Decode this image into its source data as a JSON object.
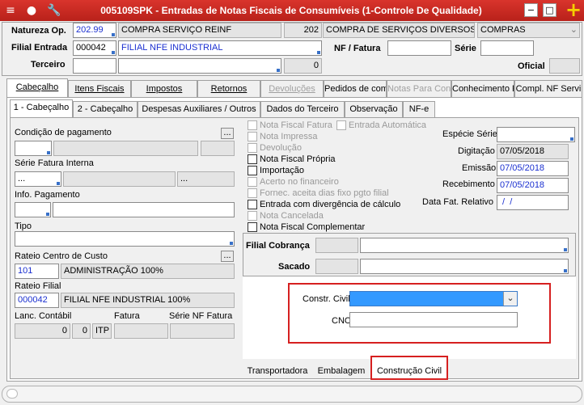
{
  "window": {
    "title": "005109SPK - Entradas de Notas Fiscais de Consumíveis (1-Controle De Qualidade)",
    "menu_icon": "menu-icon",
    "traffic_icon": "traffic-light-icon",
    "tools_icon": "wrench-icon",
    "buttons": {
      "minimize": "−",
      "maximize": "□",
      "close": "×",
      "add": "+"
    }
  },
  "header": {
    "natureza_label": "Natureza Op.",
    "natureza_code": "202.99",
    "natureza_desc": "COMPRA SERVIÇO REINF",
    "group_code": "202",
    "group_desc": "COMPRA DE SERVIÇOS DIVERSOS",
    "type_select": "COMPRAS",
    "filial_label": "Filial Entrada",
    "filial_code": "000042",
    "filial_desc": "FILIAL NFE INDUSTRIAL",
    "nf_label": "NF / Fatura",
    "serie_label": "Série",
    "terceiro_label": "Terceiro",
    "terceiro_num": "0",
    "oficial_label": "Oficial"
  },
  "tabs": [
    "Cabeçalho",
    "Itens Fiscais",
    "Impostos",
    "Retornos",
    "Devoluções",
    "Pedidos de com",
    "Notas Para Con",
    "Conhecimento F",
    "Compl. NF Servi"
  ],
  "subtabs": [
    "1 - Cabeçalho",
    "2 - Cabeçalho",
    "Despesas Auxiliares / Outros",
    "Dados do Terceiro",
    "Observação",
    "NF-e"
  ],
  "left": {
    "condicao_label": "Condição de pagamento",
    "serie_fatura_label": "Série Fatura Interna",
    "serie_fatura_values": [
      "...",
      "..."
    ],
    "info_pagamento_label": "Info. Pagamento",
    "tipo_label": "Tipo",
    "rateio_cc_label": "Rateio Centro de Custo",
    "rateio_cc_code": "101",
    "rateio_cc_desc": "ADMINISTRAÇÃO 100%",
    "rateio_filial_label": "Rateio Filial",
    "rateio_filial_code": "000042",
    "rateio_filial_desc": "FILIAL NFE INDUSTRIAL 100%",
    "lanc_label": "Lanc. Contábil",
    "fatura_label": "Fatura",
    "serie_nf_label": "Série NF Fatura",
    "lanc_values": [
      "0",
      "0",
      "ITP"
    ],
    "ellipsis": "..."
  },
  "checks": [
    {
      "label": "Nota Fiscal Fatura",
      "enabled": false
    },
    {
      "label": "Nota Impressa",
      "enabled": false
    },
    {
      "label": "Devolução",
      "enabled": false
    },
    {
      "label": "Nota Fiscal Própria",
      "enabled": true
    },
    {
      "label": "Importação",
      "enabled": true
    },
    {
      "label": "Acerto no financeiro",
      "enabled": false
    },
    {
      "label": "Fornec. aceita dias fixo pgto filial",
      "enabled": false
    },
    {
      "label": "Entrada com divergência de cálculo",
      "enabled": true
    },
    {
      "label": "Nota Cancelada",
      "enabled": false
    },
    {
      "label": "Nota Fiscal Complementar",
      "enabled": true
    }
  ],
  "entrada_automatica": "Entrada Automática",
  "right": {
    "especie_label": "Espécie Série",
    "digitacao_label": "Digitação",
    "digitacao_value": "07/05/2018",
    "emissao_label": "Emissão",
    "emissao_value": "07/05/2018",
    "recebimento_label": "Recebimento",
    "recebimento_value": "07/05/2018",
    "data_fat_label": "Data Fat. Relativo",
    "data_fat_value": " /  /"
  },
  "cobranca": {
    "filial_label": "Filial Cobrança",
    "sacado_label": "Sacado"
  },
  "construcao": {
    "constr_label": "Constr. Civil",
    "cno_label": "CNO",
    "accent": "#3399ff",
    "highlight": "#d62020"
  },
  "bottom_tabs": [
    "Transportadora",
    "Embalagem",
    "Construção Civil"
  ]
}
